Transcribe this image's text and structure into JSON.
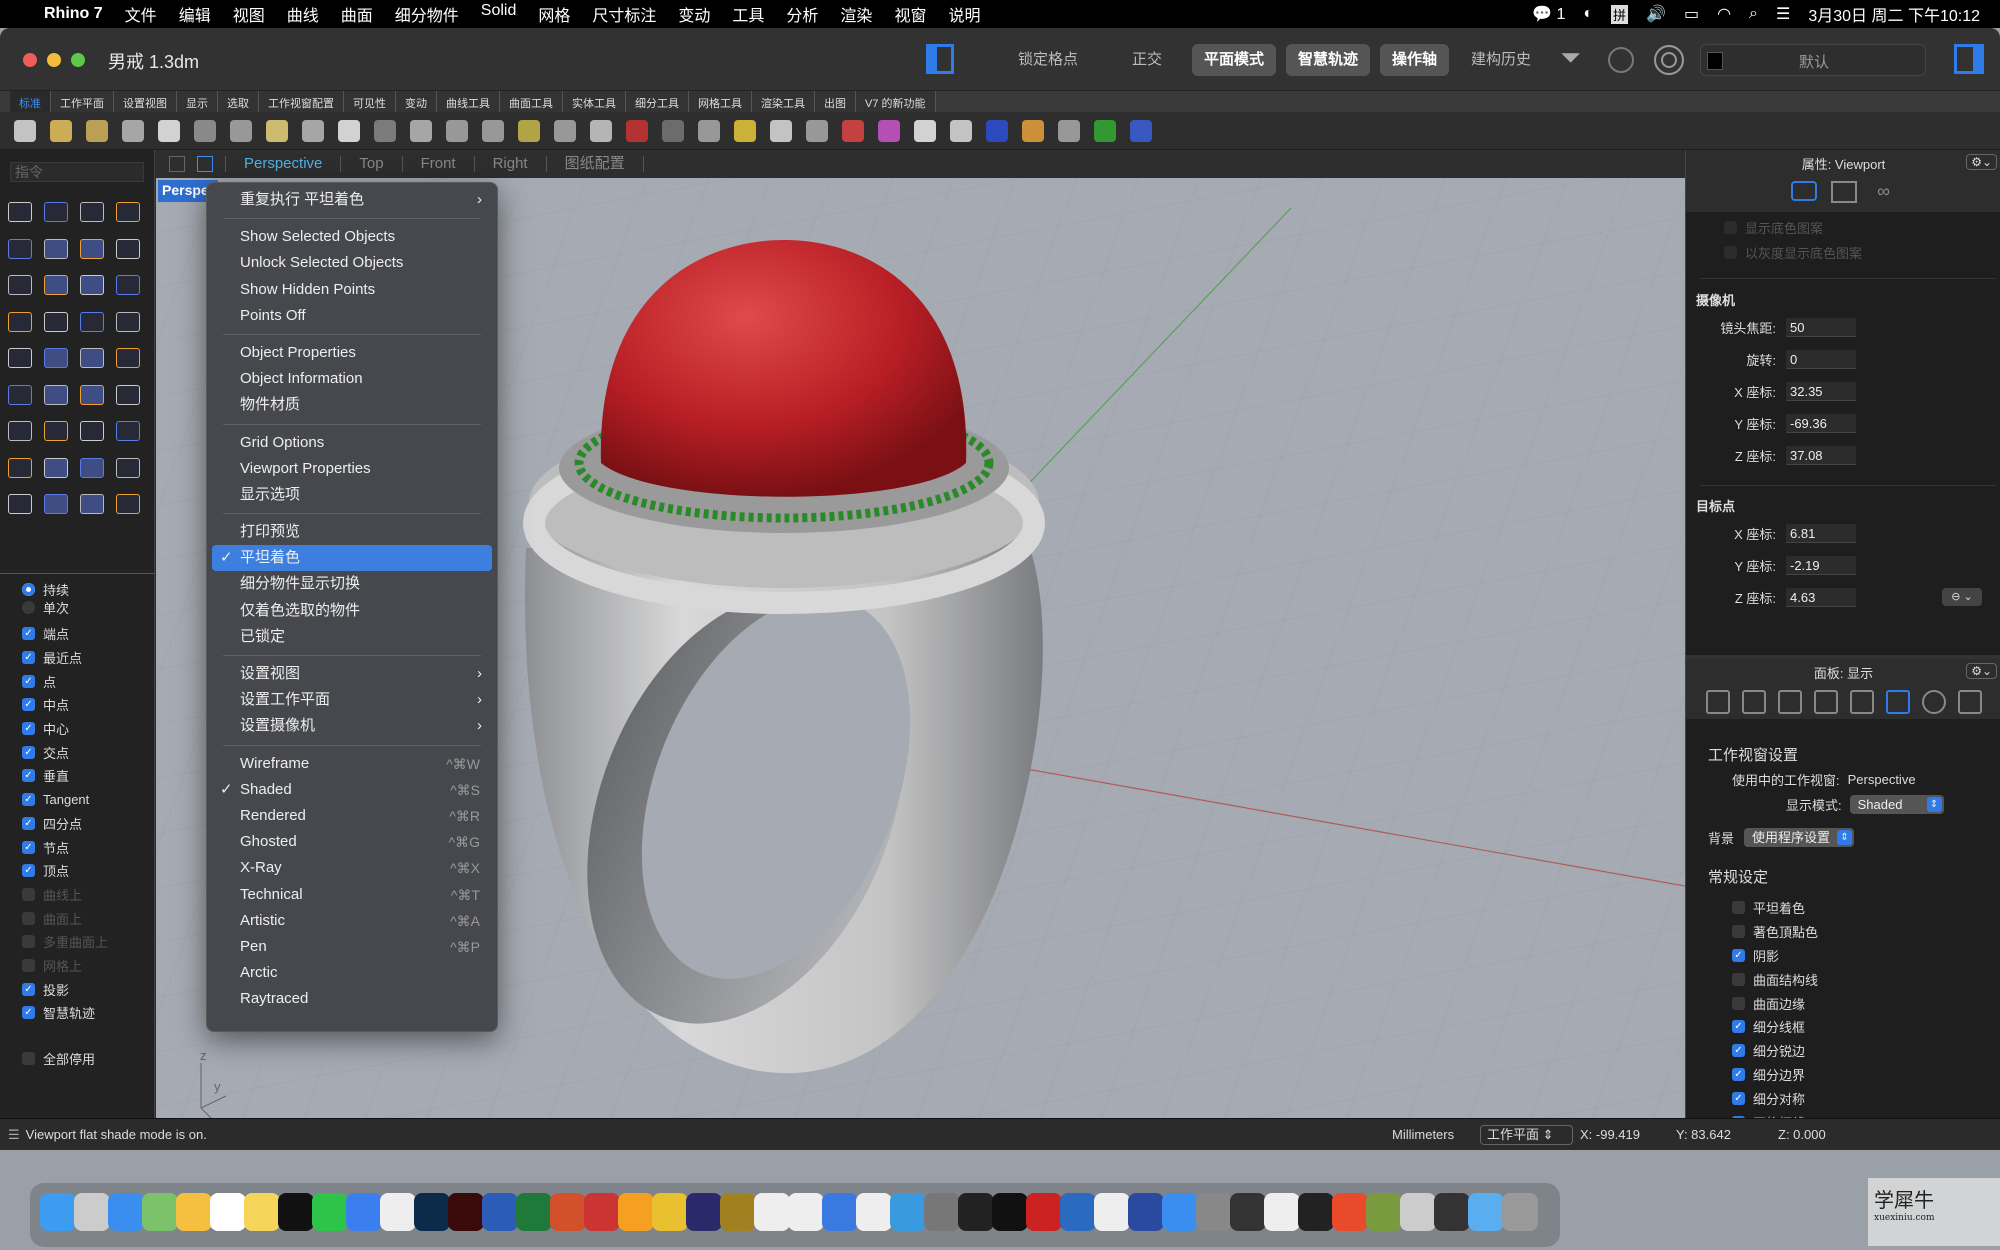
{
  "menubar": {
    "app": "Rhino 7",
    "items": [
      "文件",
      "编辑",
      "视图",
      "曲线",
      "曲面",
      "细分物件",
      "Solid",
      "网格",
      "尺寸标注",
      "变动",
      "工具",
      "分析",
      "渲染",
      "视窗",
      "说明"
    ],
    "wechat_count": "1",
    "input_method": "拼",
    "datetime": "3月30日 周二 下午10:12"
  },
  "window": {
    "title": "男戒 1.3dm",
    "buttons": [
      "锁定格点",
      "正交",
      "平面模式",
      "智慧轨迹",
      "操作轴",
      "建构历史"
    ],
    "active_buttons": [
      "平面模式",
      "智慧轨迹",
      "操作轴"
    ],
    "layer": "默认"
  },
  "tabs": [
    "标准",
    "工作平面",
    "设置视图",
    "显示",
    "选取",
    "工作视窗配置",
    "可见性",
    "变动",
    "曲线工具",
    "曲面工具",
    "实体工具",
    "细分工具",
    "网格工具",
    "渲染工具",
    "出图",
    "V7 的新功能"
  ],
  "toolbar_icons": [
    "new-icon",
    "open-icon",
    "save-icon",
    "print-icon",
    "paste-icon",
    "cut-icon",
    "copy-icon",
    "clipboard-icon",
    "undo-icon",
    "pan-hand-icon",
    "rotate-view-icon",
    "zoom-icon",
    "zoom-window-icon",
    "zoom-extents-icon",
    "zoom-selected-icon",
    "undo-view-icon",
    "four-viewports-icon",
    "car-render-icon",
    "grid-icon",
    "cplane-icon",
    "gumball-icon",
    "light-bulb-icon",
    "lock-icon",
    "layer-icon",
    "color-wheel-icon",
    "shaded-sphere-icon",
    "wire-sphere-icon",
    "rendered-sphere-icon",
    "pencil-icon",
    "dimension-icon",
    "globe-icon",
    "help-icon"
  ],
  "viewport_tabs": [
    "Perspective",
    "Top",
    "Front",
    "Right",
    "图纸配置"
  ],
  "viewport_label": "Perspective",
  "command_placeholder": "指令",
  "osnap": {
    "modes": [
      {
        "label": "持续",
        "on": true
      },
      {
        "label": "单次",
        "on": false
      }
    ],
    "items": [
      {
        "label": "端点",
        "on": true
      },
      {
        "label": "最近点",
        "on": true
      },
      {
        "label": "点",
        "on": true
      },
      {
        "label": "中点",
        "on": true
      },
      {
        "label": "中心",
        "on": true
      },
      {
        "label": "交点",
        "on": true
      },
      {
        "label": "垂直",
        "on": true
      },
      {
        "label": "Tangent",
        "on": true
      },
      {
        "label": "四分点",
        "on": true
      },
      {
        "label": "节点",
        "on": true
      },
      {
        "label": "顶点",
        "on": true
      },
      {
        "label": "曲线上",
        "on": false,
        "disabled": true
      },
      {
        "label": "曲面上",
        "on": false,
        "disabled": true
      },
      {
        "label": "多重曲面上",
        "on": false,
        "disabled": true
      },
      {
        "label": "网格上",
        "on": false,
        "disabled": true
      },
      {
        "label": "投影",
        "on": true
      },
      {
        "label": "智慧轨迹",
        "on": true
      }
    ],
    "disable_all": "全部停用"
  },
  "context_menu": [
    [
      {
        "label": "重复执行 平坦着色",
        "submenu": true
      }
    ],
    [
      {
        "label": "Show Selected Objects"
      },
      {
        "label": "Unlock Selected Objects"
      },
      {
        "label": "Show Hidden Points"
      },
      {
        "label": "Points Off"
      }
    ],
    [
      {
        "label": "Object Properties"
      },
      {
        "label": "Object Information"
      },
      {
        "label": "物件材质"
      }
    ],
    [
      {
        "label": "Grid Options"
      },
      {
        "label": "Viewport Properties"
      },
      {
        "label": "显示选项"
      }
    ],
    [
      {
        "label": "打印预览"
      },
      {
        "label": "平坦着色",
        "checked": true,
        "highlighted": true
      },
      {
        "label": "细分物件显示切换"
      },
      {
        "label": "仅着色选取的物件"
      },
      {
        "label": "已锁定"
      }
    ],
    [
      {
        "label": "设置视图",
        "submenu": true
      },
      {
        "label": "设置工作平面",
        "submenu": true
      },
      {
        "label": "设置摄像机",
        "submenu": true
      }
    ],
    [
      {
        "label": "Wireframe",
        "shortcut": "^⌘W"
      },
      {
        "label": "Shaded",
        "shortcut": "^⌘S",
        "checked": true
      },
      {
        "label": "Rendered",
        "shortcut": "^⌘R"
      },
      {
        "label": "Ghosted",
        "shortcut": "^⌘G"
      },
      {
        "label": "X-Ray",
        "shortcut": "^⌘X"
      },
      {
        "label": "Technical",
        "shortcut": "^⌘T"
      },
      {
        "label": "Artistic",
        "shortcut": "^⌘A"
      },
      {
        "label": "Pen",
        "shortcut": "^⌘P"
      },
      {
        "label": "Arctic"
      },
      {
        "label": "Raytraced"
      }
    ]
  ],
  "properties": {
    "title": "属性: Viewport",
    "faded": [
      "显示底色图案",
      "以灰度显示底色图案"
    ],
    "camera": {
      "title": "摄像机",
      "fields": [
        {
          "label": "镜头焦距:",
          "value": "50"
        },
        {
          "label": "旋转:",
          "value": "0"
        },
        {
          "label": "X 座标:",
          "value": "32.35"
        },
        {
          "label": "Y 座标:",
          "value": "-69.36"
        },
        {
          "label": "Z 座标:",
          "value": "37.08"
        }
      ]
    },
    "target": {
      "title": "目标点",
      "fields": [
        {
          "label": "X 座标:",
          "value": "6.81"
        },
        {
          "label": "Y 座标:",
          "value": "-2.19"
        },
        {
          "label": "Z 座标:",
          "value": "4.63"
        }
      ]
    }
  },
  "display_panel": {
    "title": "面板: 显示",
    "section": "工作视窗设置",
    "active_viewport_label": "使用中的工作视窗:",
    "active_viewport": "Perspective",
    "mode_label": "显示模式:",
    "mode": "Shaded",
    "bg_label": "背景",
    "bg": "使用程序设置",
    "general": "常规设定",
    "checks": [
      {
        "label": "平坦着色",
        "on": false
      },
      {
        "label": "著色頂點色",
        "on": false
      },
      {
        "label": "阴影",
        "on": true
      },
      {
        "label": "曲面结构线",
        "on": false
      },
      {
        "label": "曲面边缘",
        "on": false
      },
      {
        "label": "细分线框",
        "on": true
      },
      {
        "label": "细分锐边",
        "on": true
      },
      {
        "label": "细分边界",
        "on": true
      },
      {
        "label": "细分对称",
        "on": true
      },
      {
        "label": "网格框线",
        "on": true
      }
    ]
  },
  "statusbar": {
    "message": "Viewport flat shade mode is on.",
    "units": "Millimeters",
    "cplane": "工作平面",
    "x": "X: -99.419",
    "y": "Y: 83.642",
    "z": "Z: 0.000"
  },
  "axis": {
    "z": "z",
    "y": "y",
    "x": "x"
  },
  "watermark": "学犀牛 xuexiniu.com",
  "colors": {
    "accent": "#2f7bea",
    "highlight": "#3d7fde",
    "gem": "#c0262b",
    "pave": "#2a8a2a",
    "metal": "#c8c8c8"
  },
  "dock_icons": [
    "finder",
    "launchpad",
    "safari",
    "maps",
    "photos",
    "calendar",
    "notes",
    "qq",
    "wechat",
    "feishu",
    "chrome",
    "photoshop",
    "illustrator",
    "word",
    "excel",
    "powerpoint",
    "info",
    "sketch",
    "imovie-star",
    "eclipse",
    "ue",
    "typora",
    "numbers",
    "keynote",
    "pages",
    "baidu-netdisk",
    "system-prefs",
    "activity-monitor",
    "terminal",
    "autocad",
    "sketchup",
    "rhino",
    "cinema4d",
    "ai-tool",
    "rhino-alt",
    "calculator",
    "textedit",
    "stocks",
    "xmind",
    "archive",
    "preview",
    "scanner",
    "downloads",
    "trash"
  ]
}
